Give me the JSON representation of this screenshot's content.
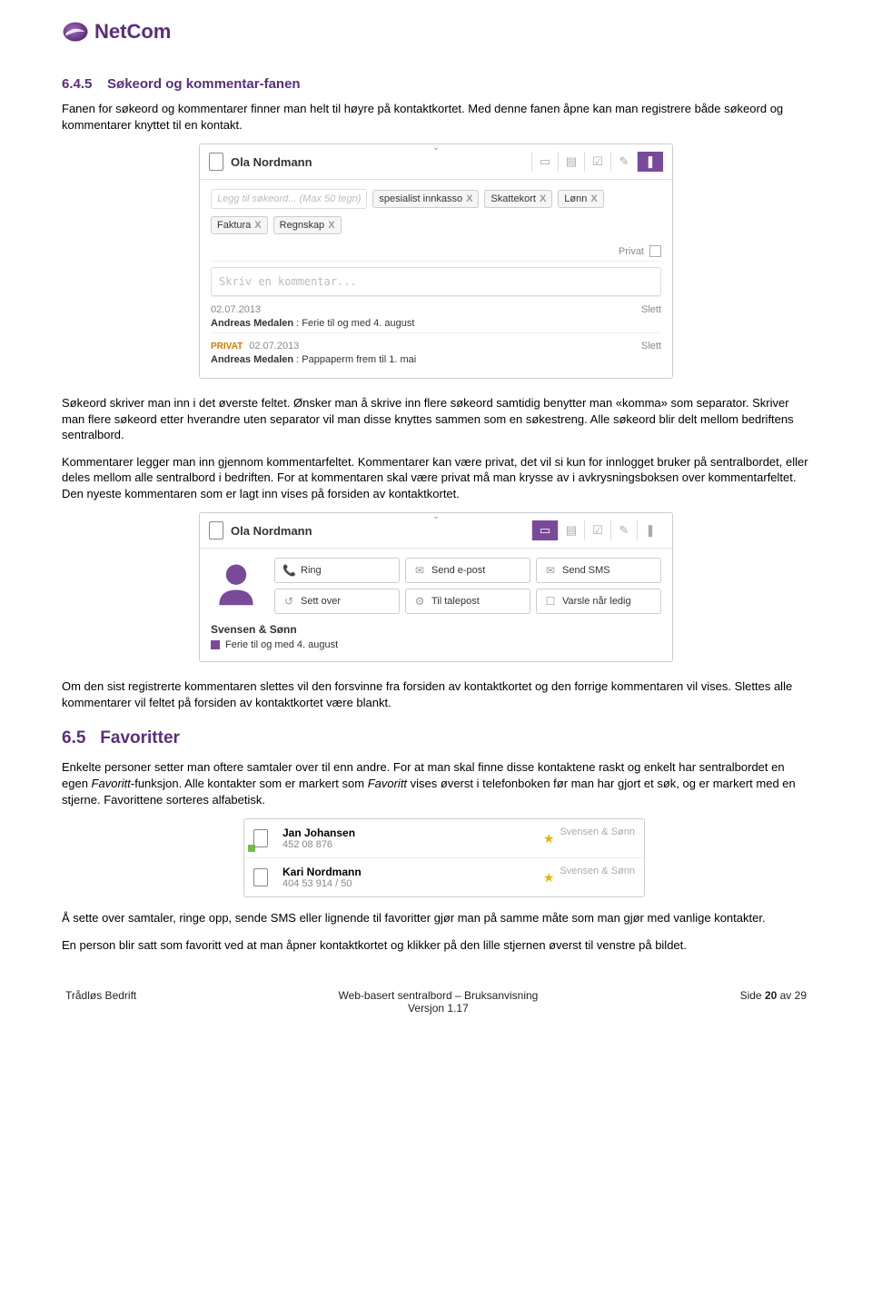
{
  "brand": {
    "name": "NetCom"
  },
  "section_645": {
    "num": "6.4.5",
    "title": "Søkeord og kommentar-fanen",
    "para1": "Fanen for søkeord og kommentarer finner man helt til høyre på kontaktkortet. Med denne fanen åpne kan man registrere både søkeord og kommentarer knyttet til en kontakt.",
    "para2": "Søkeord skriver man inn i det øverste feltet. Ønsker man å skrive inn flere søkeord samtidig benytter man «komma» som separator. Skriver man flere søkeord etter hverandre uten separator vil man disse knyttes sammen som en søkestreng. Alle søkeord blir delt mellom bedriftens sentralbord.",
    "para3": "Kommentarer legger man inn gjennom kommentarfeltet. Kommentarer kan være privat, det vil si kun for innlogget bruker på sentralbordet, eller deles mellom alle sentralbord i bedriften. For at kommentaren skal være privat må man krysse av i avkrysningsboksen over kommentarfeltet. Den nyeste kommentaren som er lagt inn vises på forsiden av kontaktkortet.",
    "para4": "Om den sist registrerte kommentaren slettes vil den forsvinne fra forsiden av kontaktkortet og den forrige kommentaren vil vises. Slettes alle kommentarer vil feltet på forsiden av kontaktkortet være blankt."
  },
  "card1": {
    "contact": "Ola Nordmann",
    "placeholder": "Legg til søkeord... (Max 50 tegn)",
    "tags": [
      "spesialist innkasso",
      "Skattekort",
      "Lønn",
      "Faktura",
      "Regnskap"
    ],
    "privat": "Privat",
    "comment_placeholder": "Skriv en kommentar...",
    "entries": [
      {
        "date": "02.07.2013",
        "author": "Andreas Medalen",
        "text": "Ferie til og med 4. august",
        "privat": false,
        "slett": "Slett"
      },
      {
        "date": "02.07.2013",
        "author": "Andreas Medalen",
        "text": "Pappaperm frem til 1. mai",
        "privat": true,
        "privat_label": "PRIVAT",
        "slett": "Slett"
      }
    ]
  },
  "card2": {
    "contact": "Ola Nordmann",
    "actions": {
      "ring": "Ring",
      "sett": "Sett over",
      "send_epost": "Send e-post",
      "talepost": "Til talepost",
      "send_sms": "Send SMS",
      "varsle": "Varsle når ledig"
    },
    "company": "Svensen & Sønn",
    "note": "Ferie til og med 4. august"
  },
  "section_65": {
    "num": "6.5",
    "title": "Favoritter",
    "para1a": "Enkelte personer setter man oftere samtaler over til enn andre. For at man skal finne disse kontaktene raskt og enkelt har sentralbordet en egen ",
    "para1b": "Favoritt",
    "para1c": "-funksjon. Alle kontakter som er markert som ",
    "para1d": "Favoritt",
    "para1e": " vises øverst i telefonboken før man har gjort et søk, og er markert med en stjerne. Favorittene sorteres alfabetisk.",
    "para2": "Å sette over samtaler, ringe opp, sende SMS eller lignende til favoritter gjør man på samme måte som man gjør med vanlige kontakter.",
    "para3": "En person blir satt som favoritt ved at man åpner kontaktkortet og klikker på den lille stjernen øverst til venstre på bildet."
  },
  "favcard": {
    "rows": [
      {
        "name": "Jan Johansen",
        "num": "452 08 876",
        "company": "Svensen & Sønn"
      },
      {
        "name": "Kari Nordmann",
        "num": "404 53 914 / 50",
        "company": "Svensen & Sønn"
      }
    ]
  },
  "footer": {
    "left": "Trådløs Bedrift",
    "center_line1": "Web-basert sentralbord – Bruksanvisning",
    "center_line2": "Versjon 1.17",
    "right_pre": "Side ",
    "right_num": "20",
    "right_post": " av 29"
  }
}
